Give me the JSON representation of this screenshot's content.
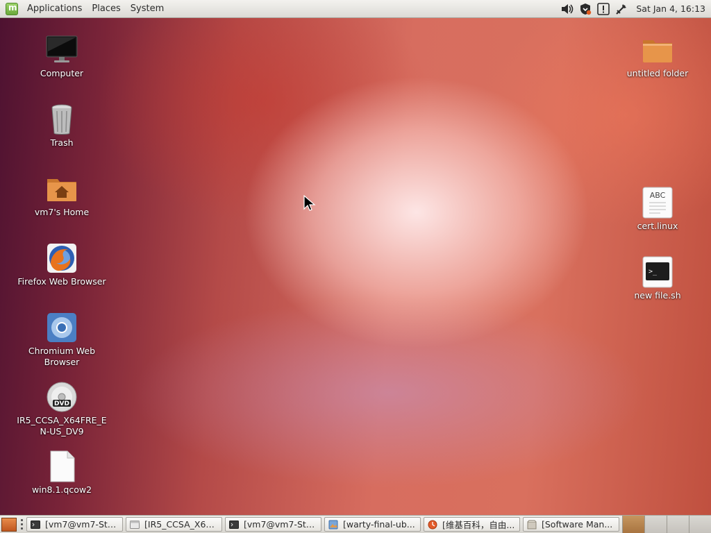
{
  "top_panel": {
    "menus": [
      {
        "label": "Applications"
      },
      {
        "label": "Places"
      },
      {
        "label": "System"
      }
    ],
    "tray_icons": [
      "volume-icon",
      "shield-update-icon",
      "notification-alert-icon",
      "network-icon"
    ],
    "clock": "Sat Jan  4, 16:13"
  },
  "desktop": {
    "left_icons": [
      {
        "label": "Computer",
        "icon": "monitor-icon"
      },
      {
        "label": "Trash",
        "icon": "trash-icon"
      },
      {
        "label": "vm7's Home",
        "icon": "home-folder-icon"
      },
      {
        "label": "Firefox Web Browser",
        "icon": "firefox-icon"
      },
      {
        "label": "Chromium Web Browser",
        "icon": "chromium-icon"
      },
      {
        "label": "IR5_CCSA_X64FRE_EN-US_DV9",
        "icon": "dvd-icon"
      },
      {
        "label": "win8.1.qcow2",
        "icon": "file-icon"
      }
    ],
    "right_icons": [
      {
        "label": "untitled folder",
        "icon": "folder-icon"
      },
      {
        "label": "cert.linux",
        "icon": "text-file-icon",
        "badge": "ABC"
      },
      {
        "label": "new file.sh",
        "icon": "script-file-icon",
        "badge": ">_"
      }
    ]
  },
  "taskbar": {
    "tasks": [
      {
        "label": "[vm7@vm7-Sta...",
        "icon": "terminal-icon"
      },
      {
        "label": "[IR5_CCSA_X64...",
        "icon": "window-icon"
      },
      {
        "label": "[vm7@vm7-Sta...",
        "icon": "terminal-icon"
      },
      {
        "label": "[warty-final-ub...",
        "icon": "image-viewer-icon"
      },
      {
        "label": "[维基百科，自由...",
        "icon": "browser-icon"
      },
      {
        "label": "[Software Man...",
        "icon": "package-icon"
      }
    ],
    "workspace_count": 4,
    "active_workspace": 1
  }
}
